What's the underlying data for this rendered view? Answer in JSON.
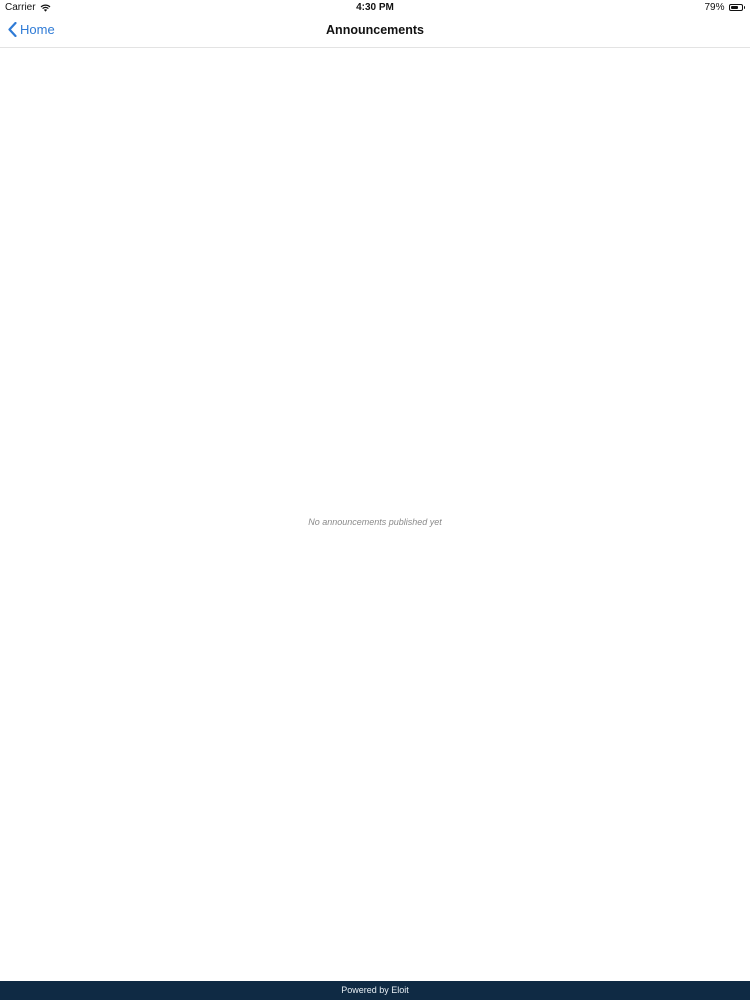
{
  "status_bar": {
    "carrier": "Carrier",
    "time": "4:30 PM",
    "battery": "79%",
    "battery_level": 0.79,
    "wifi_icon": "wifi-icon",
    "battery_icon": "battery-icon"
  },
  "nav": {
    "back_label": "Home",
    "back_icon": "chevron-left-icon",
    "title": "Announcements",
    "accent_color": "#2f7bd6"
  },
  "main": {
    "empty_message": "No announcements published yet"
  },
  "footer": {
    "text": "Powered by Eloit",
    "background_color": "#0f2a44"
  }
}
